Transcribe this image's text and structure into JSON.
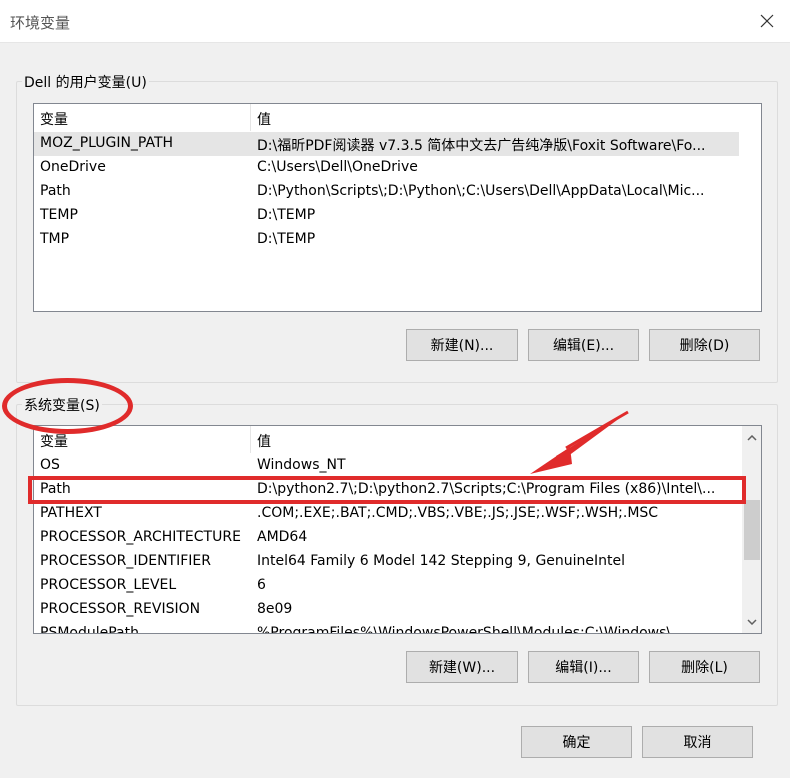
{
  "window": {
    "title": "环境变量"
  },
  "user_vars": {
    "group_label": "Dell 的用户变量(U)",
    "columns": [
      "变量",
      "值"
    ],
    "rows": [
      {
        "name": "MOZ_PLUGIN_PATH",
        "value": "D:\\福昕PDF阅读器 v7.3.5 简体中文去广告纯净版\\Foxit Software\\Fo..."
      },
      {
        "name": "OneDrive",
        "value": "C:\\Users\\Dell\\OneDrive"
      },
      {
        "name": "Path",
        "value": "D:\\Python\\Scripts\\;D:\\Python\\;C:\\Users\\Dell\\AppData\\Local\\Mic..."
      },
      {
        "name": "TEMP",
        "value": "D:\\TEMP"
      },
      {
        "name": "TMP",
        "value": "D:\\TEMP"
      }
    ],
    "buttons": {
      "new": "新建(N)...",
      "edit": "编辑(E)...",
      "delete": "删除(D)"
    }
  },
  "system_vars": {
    "group_label": "系统变量(S)",
    "columns": [
      "变量",
      "值"
    ],
    "rows": [
      {
        "name": "OS",
        "value": "Windows_NT"
      },
      {
        "name": "Path",
        "value": "D:\\python2.7\\;D:\\python2.7\\Scripts;C:\\Program Files (x86)\\Intel\\..."
      },
      {
        "name": "PATHEXT",
        "value": ".COM;.EXE;.BAT;.CMD;.VBS;.VBE;.JS;.JSE;.WSF;.WSH;.MSC"
      },
      {
        "name": "PROCESSOR_ARCHITECTURE",
        "value": "AMD64"
      },
      {
        "name": "PROCESSOR_IDENTIFIER",
        "value": "Intel64 Family 6 Model 142 Stepping 9, GenuineIntel"
      },
      {
        "name": "PROCESSOR_LEVEL",
        "value": "6"
      },
      {
        "name": "PROCESSOR_REVISION",
        "value": "8e09"
      },
      {
        "name": "PSModulePath",
        "value": "%ProgramFiles%\\WindowsPowerShell\\Modules;C:\\Windows\\..."
      }
    ],
    "buttons": {
      "new": "新建(W)...",
      "edit": "编辑(I)...",
      "delete": "删除(L)"
    }
  },
  "footer": {
    "ok": "确定",
    "cancel": "取消"
  },
  "colors": {
    "annotation": "#e02b2b",
    "selection": "#e5e5e5",
    "list_border": "#828790"
  },
  "icons": {
    "close": "close-icon",
    "scroll_up": "chevron-up-icon",
    "scroll_down": "chevron-down-icon"
  }
}
